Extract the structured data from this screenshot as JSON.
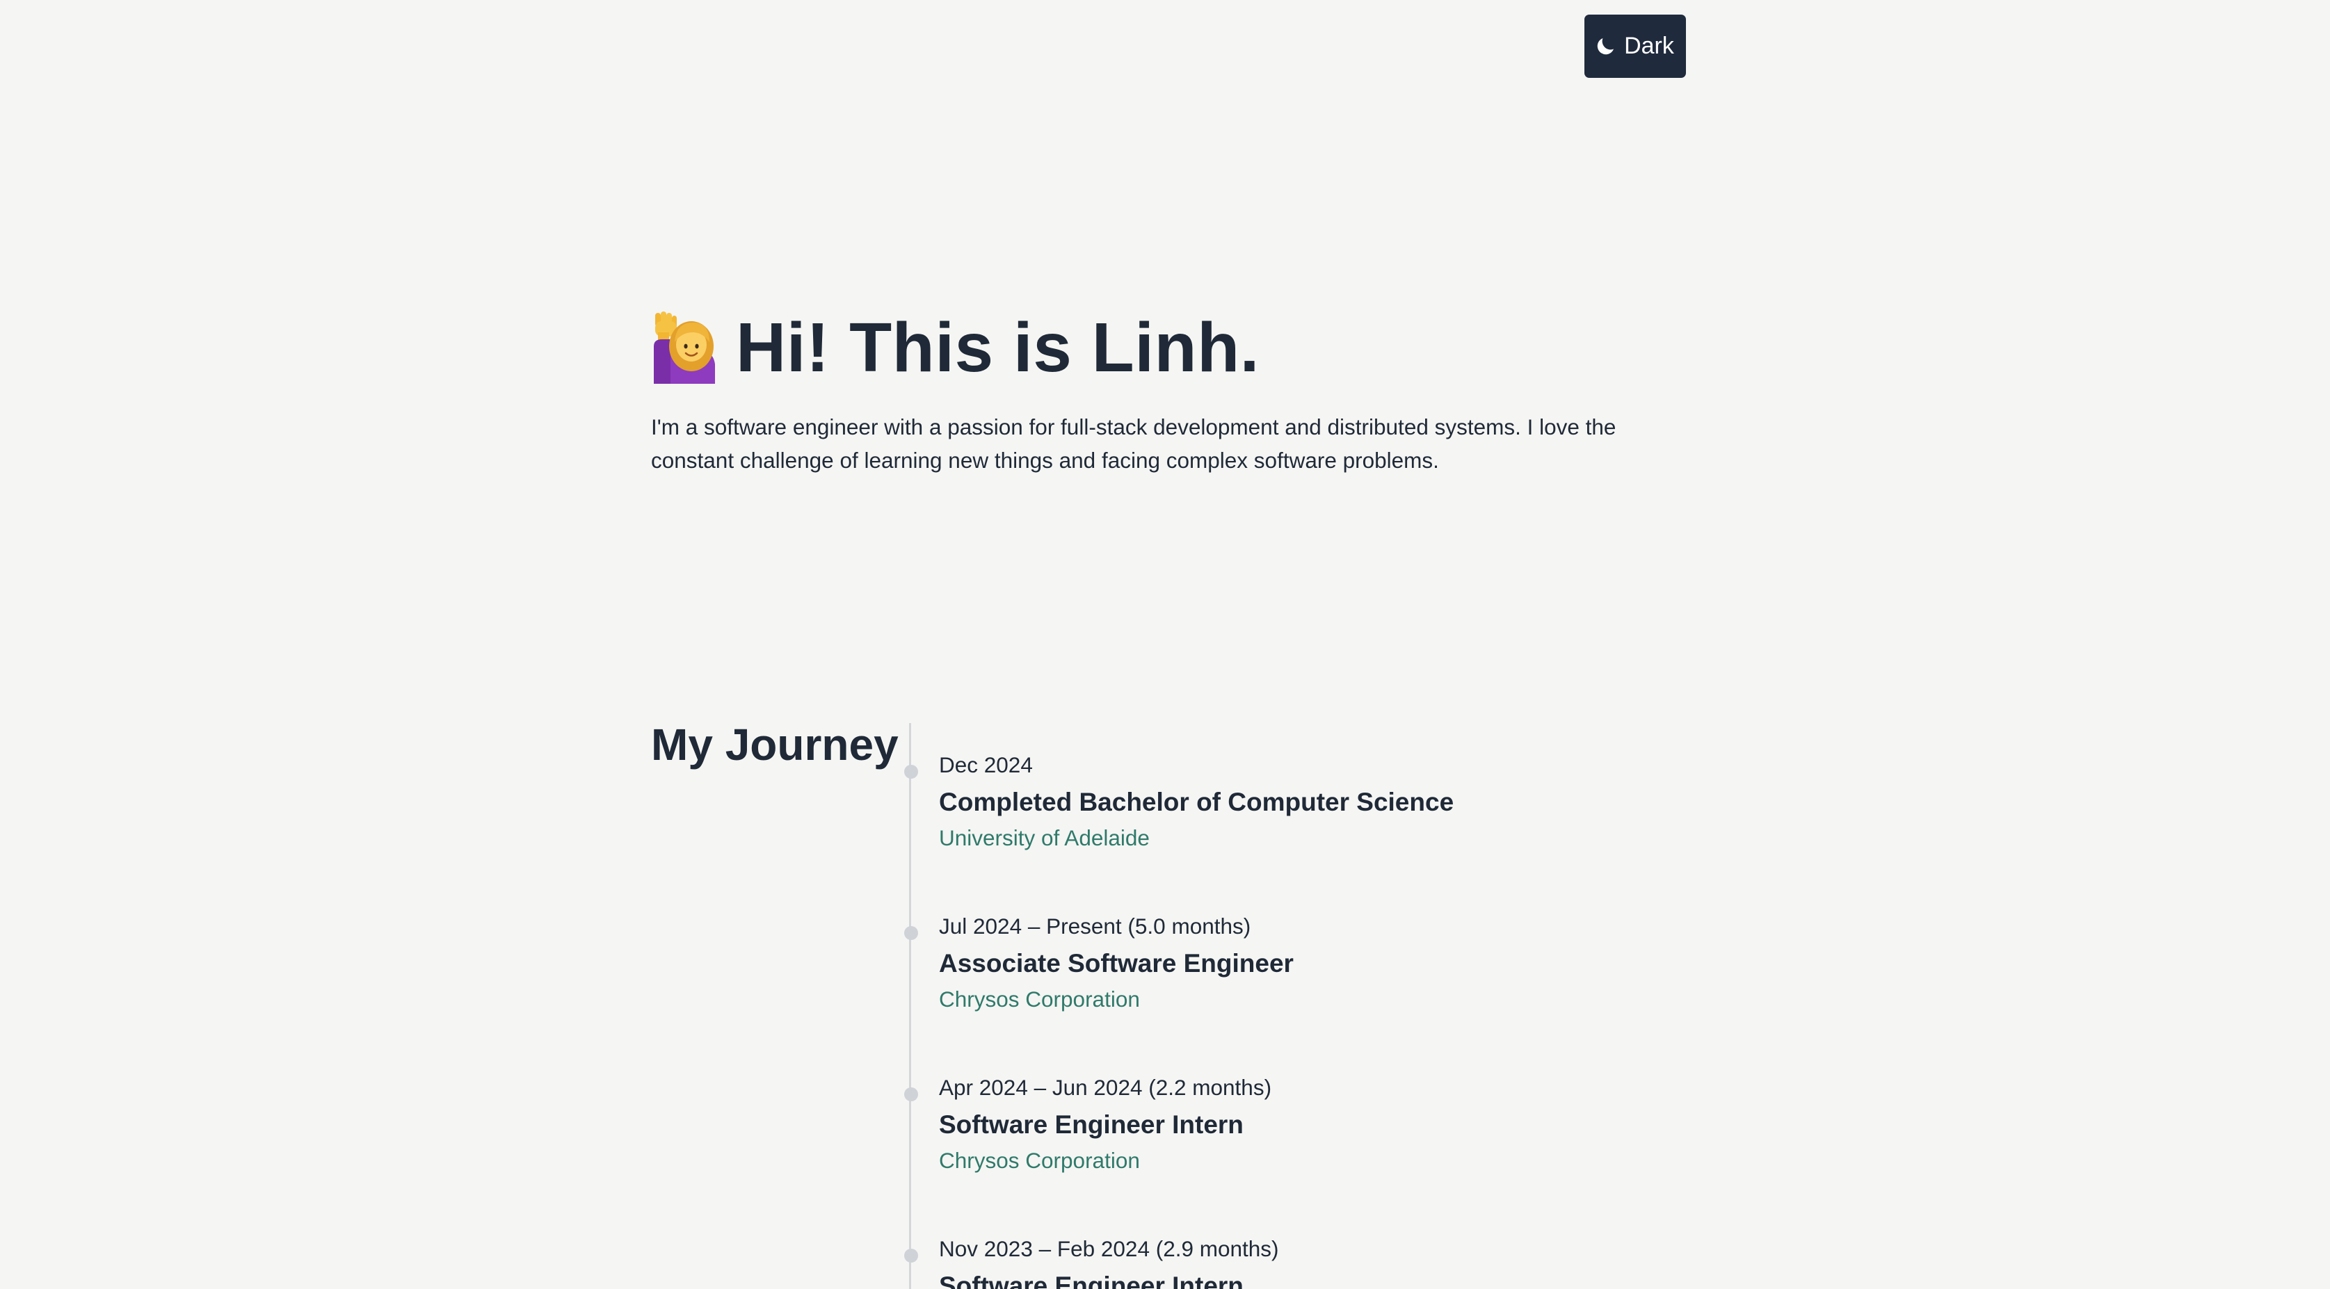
{
  "theme_toggle": {
    "icon": "moon-icon",
    "label": "Dark"
  },
  "hero": {
    "emoji_icon": "person-raising-hand-icon",
    "title": "Hi! This is Linh.",
    "description": "I'm a software engineer with a passion for full-stack development and distributed systems. I love the constant challenge of learning new things and facing complex software problems."
  },
  "journey": {
    "title": "My Journey",
    "items": [
      {
        "date": "Dec 2024",
        "title": "Completed Bachelor of Computer Science",
        "org": "University of Adelaide"
      },
      {
        "date": "Jul 2024 – Present (5.0 months)",
        "title": "Associate Software Engineer",
        "org": "Chrysos Corporation"
      },
      {
        "date": "Apr 2024 – Jun 2024 (2.2 months)",
        "title": "Software Engineer Intern",
        "org": "Chrysos Corporation"
      },
      {
        "date": "Nov 2023 – Feb 2024 (2.9 months)",
        "title": "Software Engineer Intern",
        "org": ""
      }
    ]
  },
  "colors": {
    "background": "#f5f5f3",
    "text": "#1f2937",
    "toggle_bg": "#1f2a3c",
    "link": "#2f7a6a",
    "timeline": "#d4d6da"
  }
}
